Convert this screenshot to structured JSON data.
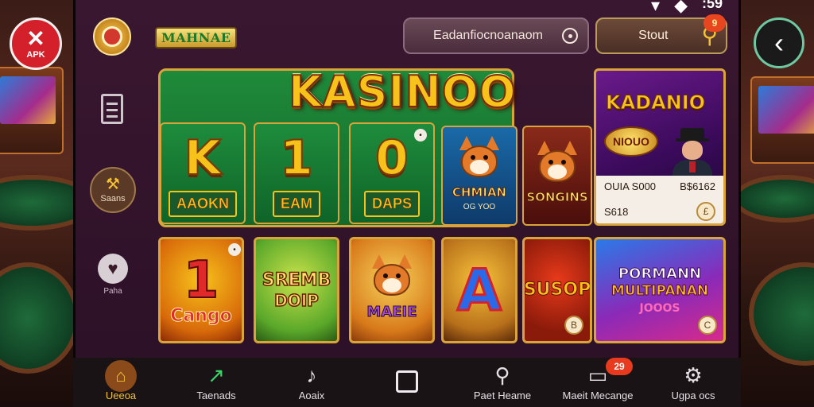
{
  "top_bar": {
    "brand": "MAHNAE",
    "search_label": "Eadanfiocnoanaom",
    "start_label": "Stout",
    "notification_count": "9",
    "status_time": ":59"
  },
  "corner": {
    "apk_label": "APK"
  },
  "rail": {
    "games_label": "Saans",
    "fav_label": "Paha"
  },
  "hero": {
    "title": "KASINOO"
  },
  "tiles": {
    "k": {
      "letter": "K",
      "plate": "AAOKN"
    },
    "one": {
      "letter": "1",
      "plate": "EAM"
    },
    "zero": {
      "letter": "0",
      "plate": "DAPS"
    },
    "fox1": {
      "banner": "CHMIAN",
      "sub": "OG YOO"
    },
    "fox2": {
      "banner": "SONGINS"
    },
    "promo": {
      "title": "KADANIO",
      "badge": "NIOUO",
      "line1_left": "OUIA S000",
      "line1_right": "B$6162",
      "line2_left": "S618",
      "coin": "£"
    },
    "r2_1": {
      "big": "1",
      "word": "Cango"
    },
    "r2_2": {
      "big": "SREMB",
      "word": "DOIP"
    },
    "r2_3": {
      "word": "MAEIE"
    },
    "r2_4": {
      "big": "A"
    },
    "r2_5": {
      "big": "SUSOP",
      "coin": "B"
    },
    "r2_6": {
      "line1": "PORMANN",
      "line2": "MULTIPANAN",
      "line3": "JOOOS",
      "coin": "C"
    }
  },
  "bottom_nav": [
    {
      "label": "Ueeoa",
      "icon": "home-icon"
    },
    {
      "label": "Taenads",
      "icon": "trend-icon"
    },
    {
      "label": "Aoaix",
      "icon": "music-note-icon"
    },
    {
      "label": "",
      "icon": "square-icon"
    },
    {
      "label": "Paet Heame",
      "icon": "search-icon"
    },
    {
      "label": "Maeit Mecange",
      "icon": "window-icon",
      "badge": "29"
    },
    {
      "label": "Ugpa ocs",
      "icon": "gear-icon"
    }
  ],
  "colors": {
    "gold": "#f7c21a",
    "green": "#1f8a3a",
    "purple": "#6a1a8a",
    "frame": "#d9a43a"
  }
}
